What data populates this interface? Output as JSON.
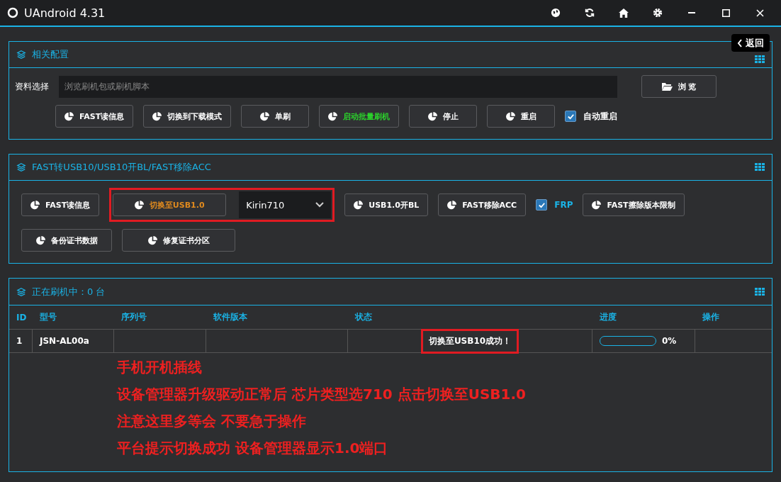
{
  "window": {
    "title": "UAndroid 4.31"
  },
  "back_button": {
    "label": "返回"
  },
  "config_panel": {
    "title": "相关配置",
    "field_label": "资料选择",
    "field": {
      "placeholder": "浏览刷机包或刷机脚本"
    },
    "browse_button": "浏 览",
    "buttons": [
      {
        "label": "FAST读信息"
      },
      {
        "label": "切换到下载模式"
      },
      {
        "label": "单刷"
      },
      {
        "label": "启动批量刷机",
        "color": "#2bd42b"
      },
      {
        "label": "停止"
      },
      {
        "label": "重启"
      }
    ],
    "auto_restart": {
      "label": "自动重启",
      "checked": true
    }
  },
  "fast_panel": {
    "title": "FAST转USB10/USB10开BL/FAST移除ACC",
    "row1": [
      {
        "kind": "button",
        "label": "FAST读信息"
      },
      {
        "kind": "highlight",
        "button": {
          "label": "切换至USB1.0",
          "color": "#e08a1e"
        },
        "select": {
          "value": "Kirin710"
        }
      },
      {
        "kind": "button",
        "label": "USB1.0开BL"
      },
      {
        "kind": "button",
        "label": "FAST移除ACC"
      },
      {
        "kind": "checkbox",
        "label": "FRP",
        "checked": true
      },
      {
        "kind": "button",
        "label": "FAST擦除版本限制"
      }
    ],
    "row2": [
      {
        "label": "备份证书数据"
      },
      {
        "label": "修复证书分区"
      }
    ]
  },
  "flash_panel": {
    "title": "正在刷机中：0 台",
    "table": {
      "columns": [
        "ID",
        "型号",
        "序列号",
        "软件版本",
        "状态",
        "进度",
        "操作"
      ],
      "rows": [
        {
          "id": "1",
          "model": "JSN-AL00a",
          "status": "切换至USB10成功！",
          "status_highlighted": true,
          "level": 0,
          "progress": "0%"
        }
      ]
    },
    "notes": [
      "手机开机插线",
      "设备管理器升级驱动正常后 芯片类型选710 点击切换至USB1.0",
      "注意这里多等会 不要急于操作",
      "平台提示切换成功 设备管理器显示1.0端口"
    ]
  }
}
